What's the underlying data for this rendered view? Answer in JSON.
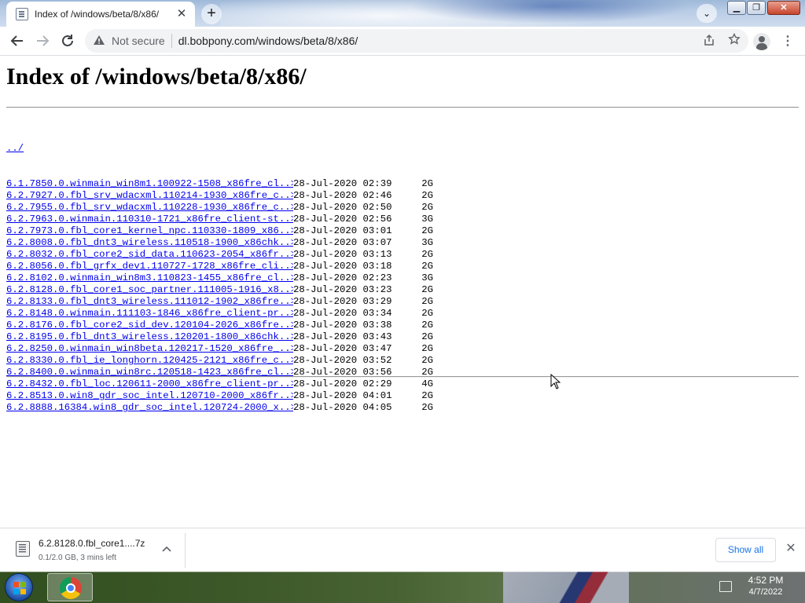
{
  "browser": {
    "tab_title": "Index of /windows/beta/8/x86/",
    "tab_close": "✕",
    "new_tab": "+",
    "tab_search": "⌄",
    "window_buttons": {
      "minimize": "▁",
      "maximize": "❐",
      "close": "✕"
    },
    "security_label": "Not secure",
    "url": "dl.bobpony.com/windows/beta/8/x86/"
  },
  "page": {
    "title": "Index of /windows/beta/8/x86/",
    "parent_link": "../",
    "entries": [
      {
        "name": "6.1.7850.0.winmain_win8m1.100922-1508_x86fre_cl..>",
        "date": "28-Jul-2020 02:39",
        "size": "2G"
      },
      {
        "name": "6.2.7927.0.fbl_srv_wdacxml.110214-1930_x86fre_c..>",
        "date": "28-Jul-2020 02:46",
        "size": "2G"
      },
      {
        "name": "6.2.7955.0.fbl_srv_wdacxml.110228-1930_x86fre_c..>",
        "date": "28-Jul-2020 02:50",
        "size": "2G"
      },
      {
        "name": "6.2.7963.0.winmain.110310-1721_x86fre_client-st..>",
        "date": "28-Jul-2020 02:56",
        "size": "3G"
      },
      {
        "name": "6.2.7973.0.fbl_core1_kernel_npc.110330-1809_x86..>",
        "date": "28-Jul-2020 03:01",
        "size": "2G"
      },
      {
        "name": "6.2.8008.0.fbl_dnt3_wireless.110518-1900_x86chk..>",
        "date": "28-Jul-2020 03:07",
        "size": "3G"
      },
      {
        "name": "6.2.8032.0.fbl_core2_sid_data.110623-2054_x86fr..>",
        "date": "28-Jul-2020 03:13",
        "size": "2G"
      },
      {
        "name": "6.2.8056.0.fbl_grfx_dev1.110727-1728_x86fre_cli..>",
        "date": "28-Jul-2020 03:18",
        "size": "2G"
      },
      {
        "name": "6.2.8102.0.winmain_win8m3.110823-1455_x86fre_cl..>",
        "date": "28-Jul-2020 02:23",
        "size": "3G"
      },
      {
        "name": "6.2.8128.0.fbl_core1_soc_partner.111005-1916_x8..>",
        "date": "28-Jul-2020 03:23",
        "size": "2G"
      },
      {
        "name": "6.2.8133.0.fbl_dnt3_wireless.111012-1902_x86fre..>",
        "date": "28-Jul-2020 03:29",
        "size": "2G"
      },
      {
        "name": "6.2.8148.0.winmain.111103-1846_x86fre_client-pr..>",
        "date": "28-Jul-2020 03:34",
        "size": "2G"
      },
      {
        "name": "6.2.8176.0.fbl_core2_sid_dev.120104-2026_x86fre..>",
        "date": "28-Jul-2020 03:38",
        "size": "2G"
      },
      {
        "name": "6.2.8195.0.fbl_dnt3_wireless.120201-1800_x86chk..>",
        "date": "28-Jul-2020 03:43",
        "size": "2G"
      },
      {
        "name": "6.2.8250.0.winmain_win8beta.120217-1520_x86fre_..>",
        "date": "28-Jul-2020 03:47",
        "size": "2G"
      },
      {
        "name": "6.2.8330.0.fbl_ie_longhorn.120425-2121_x86fre_c..>",
        "date": "28-Jul-2020 03:52",
        "size": "2G"
      },
      {
        "name": "6.2.8400.0.winmain_win8rc.120518-1423_x86fre_cl..>",
        "date": "28-Jul-2020 03:56",
        "size": "2G"
      },
      {
        "name": "6.2.8432.0.fbl_loc.120611-2000_x86fre_client-pr..>",
        "date": "28-Jul-2020 02:29",
        "size": "4G"
      },
      {
        "name": "6.2.8513.0.win8_gdr_soc_intel.120710-2000_x86fr..>",
        "date": "28-Jul-2020 04:01",
        "size": "2G"
      },
      {
        "name": "6.2.8888.16384.win8_gdr_soc_intel.120724-2000_x..>",
        "date": "28-Jul-2020 04:05",
        "size": "2G"
      }
    ]
  },
  "downloads": {
    "file_name": "6.2.8128.0.fbl_core1....7z",
    "status": "0.1/2.0 GB, 3 mins left",
    "show_all": "Show all",
    "close": "✕"
  },
  "taskbar": {
    "time": "4:52 PM",
    "date": "4/7/2022"
  }
}
